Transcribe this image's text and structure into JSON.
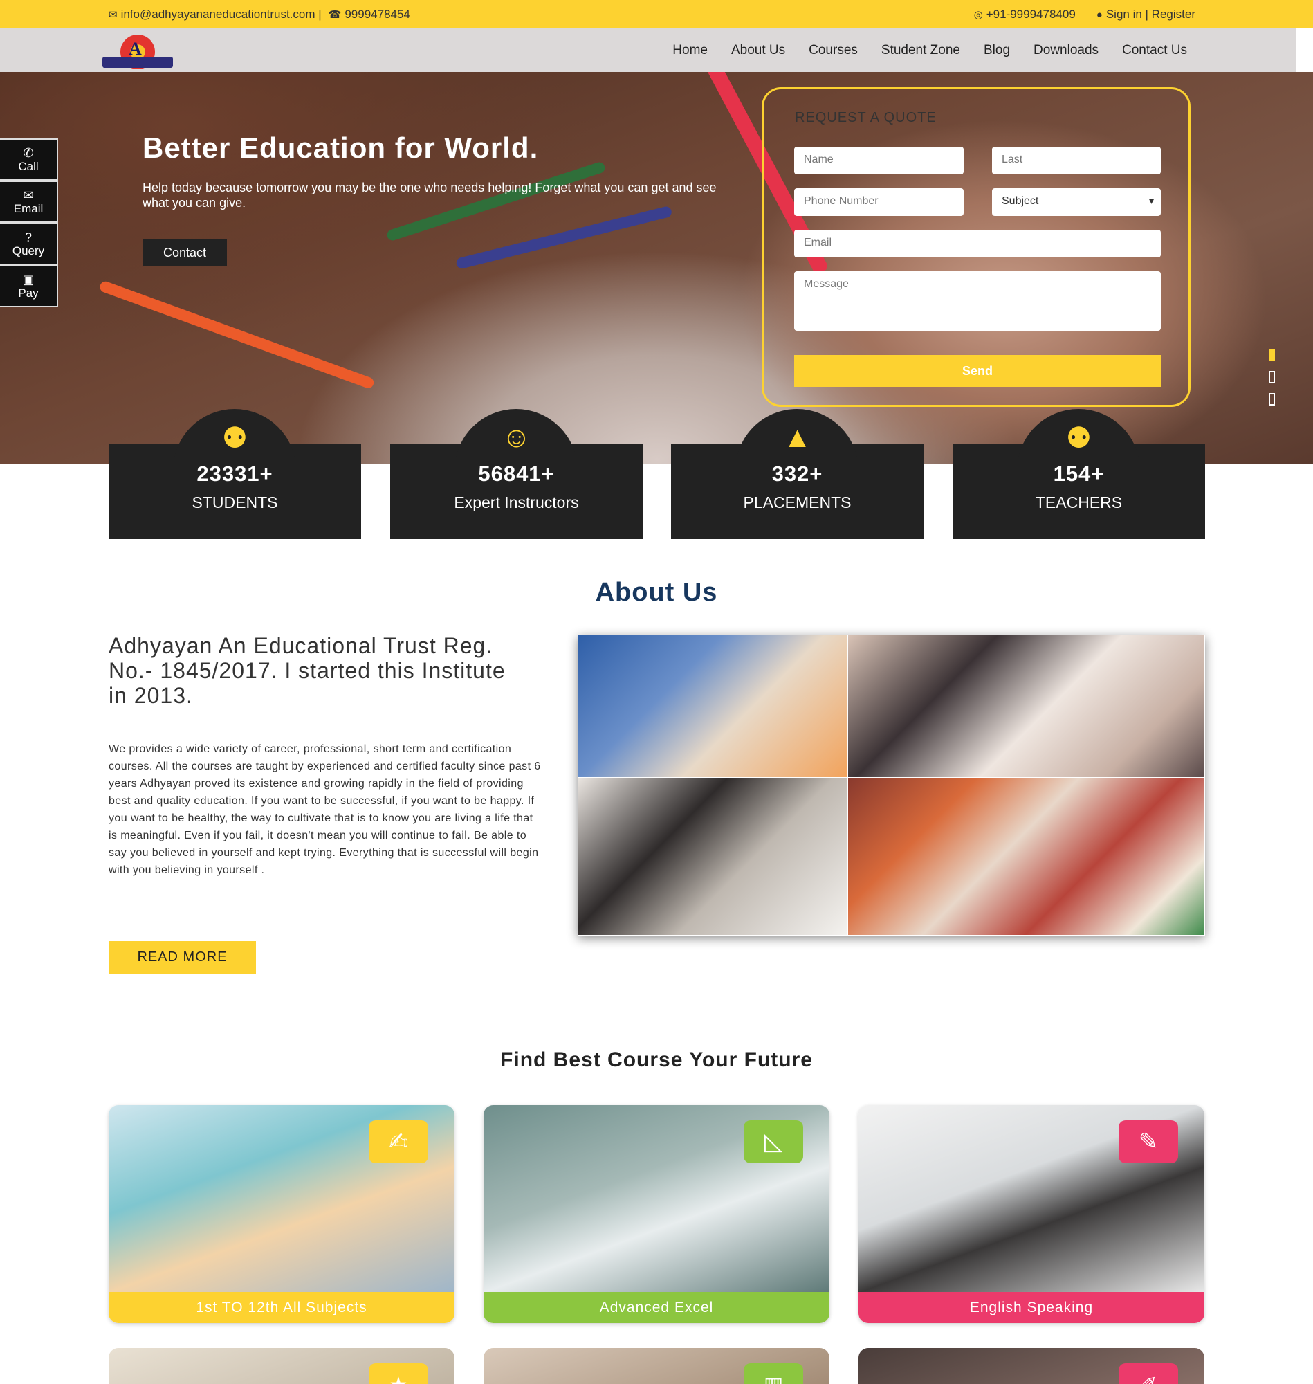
{
  "topbar": {
    "email": "info@adhyayananeducationtrust.com |",
    "phone": "9999478454",
    "whatsapp": "+91-9999478409",
    "auth": "Sign in | Register"
  },
  "nav": {
    "items": [
      "Home",
      "About Us",
      "Courses",
      "Student Zone",
      "Blog",
      "Downloads",
      "Contact Us"
    ]
  },
  "hero": {
    "title": "Better Education for World.",
    "subtitle": "Help today because tomorrow you may be the one who needs helping! Forget what you can get and see what you can give.",
    "button": "Contact"
  },
  "quote": {
    "title": "REQUEST A QUOTE",
    "name_placeholder": "Name",
    "last_placeholder": "Last",
    "phone_placeholder": "Phone Number",
    "subject_value": "Subject",
    "email_placeholder": "Email",
    "message_placeholder": "Message",
    "send": "Send"
  },
  "side_buttons": [
    {
      "label": "Call",
      "icon": "phone-icon"
    },
    {
      "label": "Email",
      "icon": "envelope-icon"
    },
    {
      "label": "Query",
      "icon": "question-icon"
    },
    {
      "label": "Pay",
      "icon": "money-icon"
    }
  ],
  "stats": [
    {
      "value": "23331+",
      "label": "STUDENTS",
      "icon": "users-icon"
    },
    {
      "value": "56841+",
      "label": "Expert Instructors",
      "icon": "accessibility-icon"
    },
    {
      "value": "332+",
      "label": "PLACEMENTS",
      "icon": "graduation-cap-icon"
    },
    {
      "value": "154+",
      "label": "TEACHERS",
      "icon": "users-icon"
    }
  ],
  "about": {
    "title": "About Us",
    "heading": "Adhyayan An Educational Trust Reg. No.- 1845/2017. I started this Institute in 2013.",
    "body": "We provides a wide variety of career, professional, short term and certification courses. All the courses are taught by experienced and certified faculty since past 6 years Adhyayan proved its existence and growing rapidly in the field of providing best and quality education. If you want to be successful, if you want to be happy. If you want to be healthy, the way to cultivate that is to know you are living a life that is meaningful. Even if you fail, it doesn't mean you will continue to fail. Be able to say you believed in yourself and kept trying. Everything that is successful will begin with you believing in yourself .",
    "button": "READ MORE"
  },
  "courses": {
    "title": "Find Best Course Your Future",
    "items": [
      {
        "label": "1st TO 12th All Subjects",
        "color": "#fdd230",
        "icon": "hand-writing-icon"
      },
      {
        "label": "Advanced Excel",
        "color": "#8cc63f",
        "icon": "set-square-icon"
      },
      {
        "label": "English Speaking",
        "color": "#ec3a6b",
        "icon": "open-book-icon"
      }
    ]
  },
  "colors": {
    "accent": "#fdd230",
    "dark": "#222222",
    "title_blue": "#17375e"
  }
}
